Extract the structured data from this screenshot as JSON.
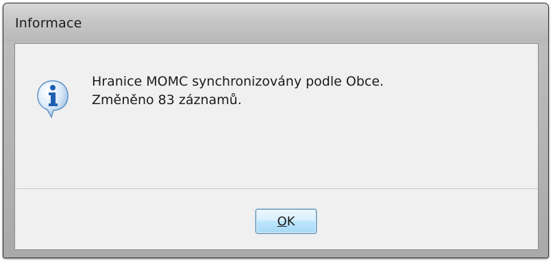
{
  "dialog": {
    "title": "Informace",
    "icon": "information-icon",
    "message_line1": "Hranice MOMC synchronizovány podle Obce.",
    "message_line2": "Změněno 83 záznamů.",
    "ok_mnemonic": "O",
    "ok_rest": "K"
  },
  "colors": {
    "accent_border": "#3c7fb1",
    "icon_blue": "#1d5fb0"
  }
}
